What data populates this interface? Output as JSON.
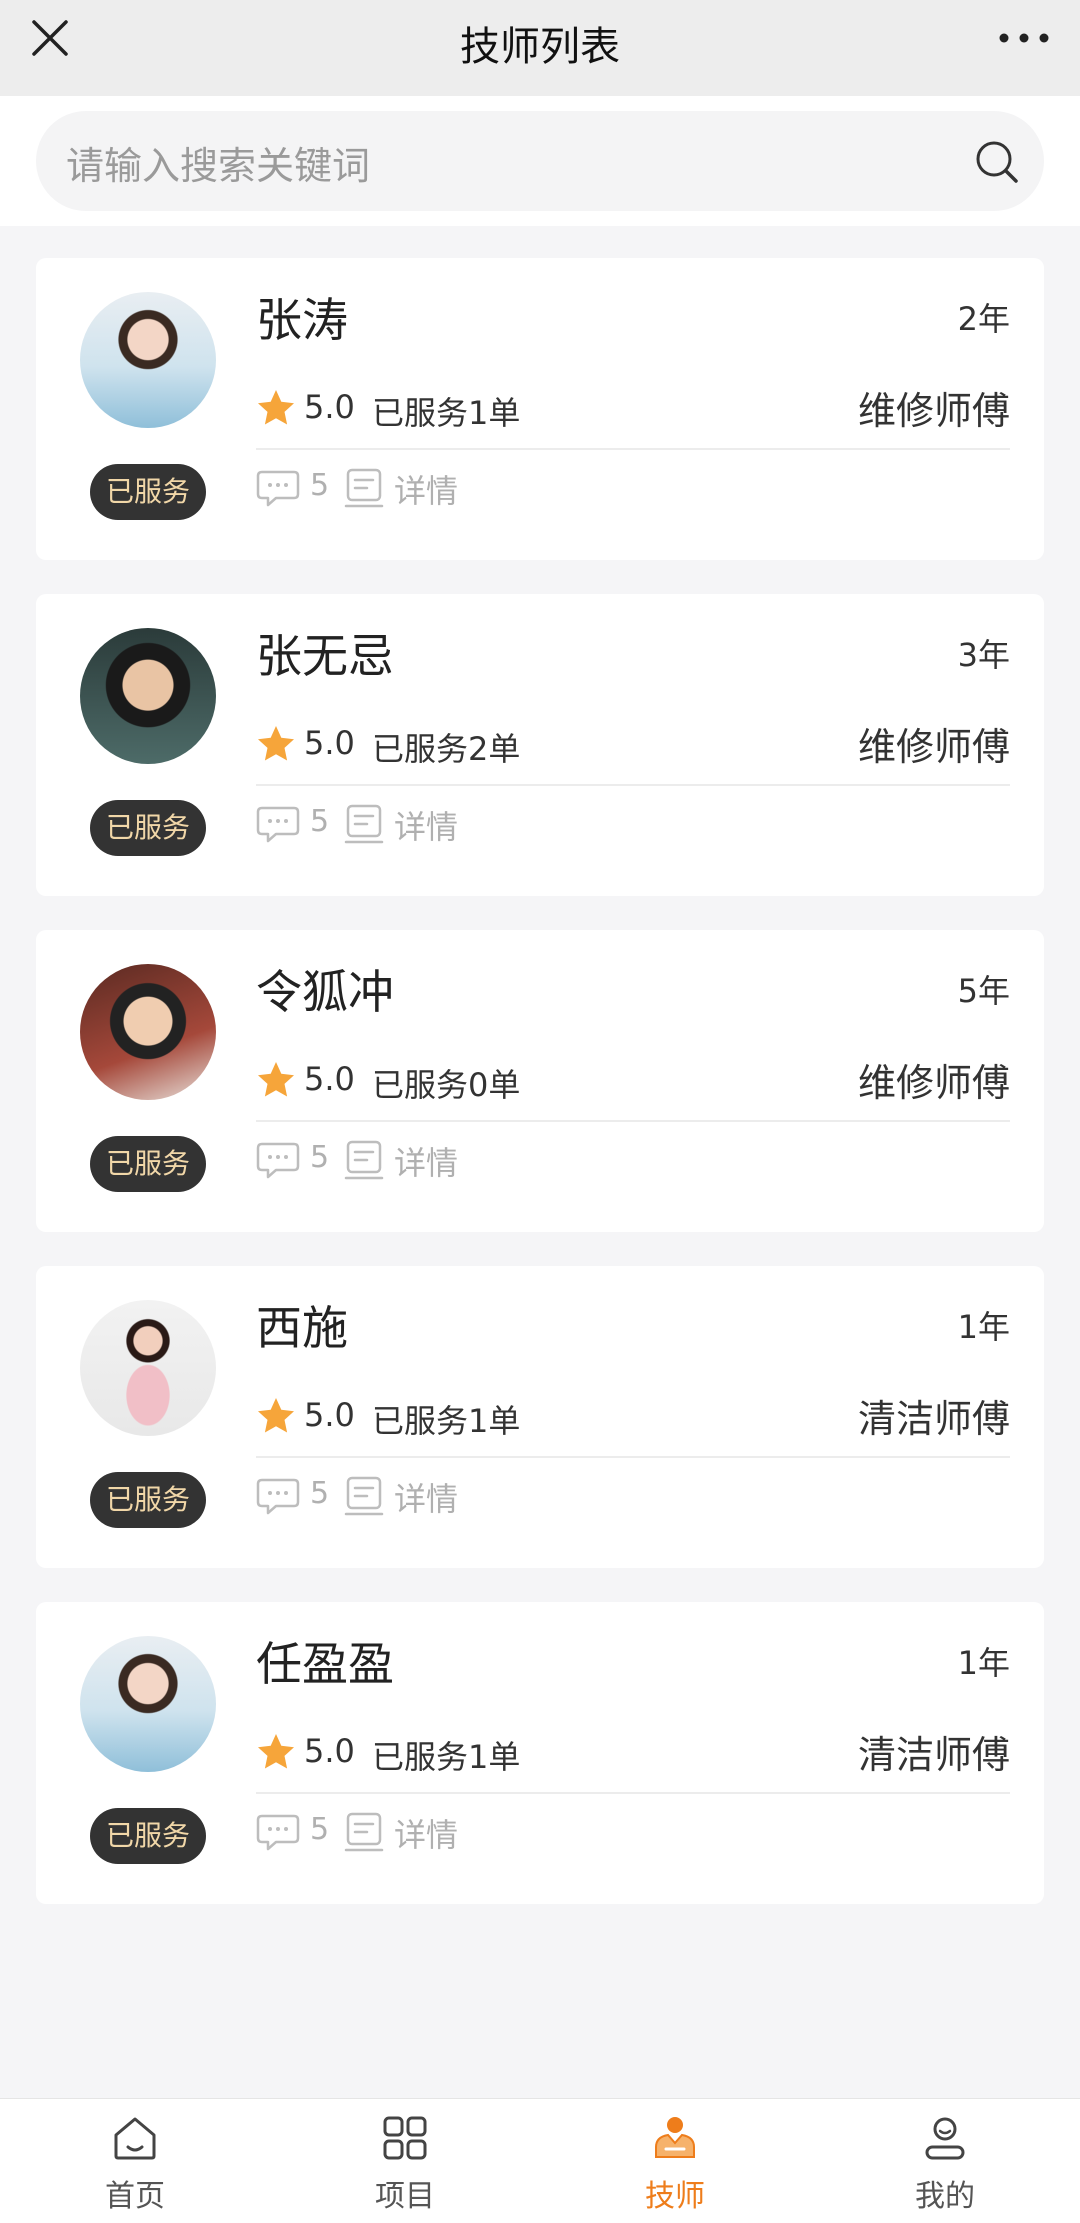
{
  "header": {
    "title": "技师列表",
    "close_icon": "close-icon",
    "more_icon": "more-dots-icon"
  },
  "search": {
    "placeholder": "请输入搜索关键词",
    "icon": "search-icon"
  },
  "colors": {
    "accent": "#ee7d1b",
    "star": "#f6a53a",
    "badge_bg": "#333333",
    "badge_text": "#f1d7a8"
  },
  "technicians": [
    {
      "name": "张涛",
      "years": "2年",
      "rating": "5.0",
      "served": "已服务1单",
      "role": "维修师傅",
      "badge": "已服务",
      "comments": "5",
      "detail": "详情"
    },
    {
      "name": "张无忌",
      "years": "3年",
      "rating": "5.0",
      "served": "已服务2单",
      "role": "维修师傅",
      "badge": "已服务",
      "comments": "5",
      "detail": "详情"
    },
    {
      "name": "令狐冲",
      "years": "5年",
      "rating": "5.0",
      "served": "已服务0单",
      "role": "维修师傅",
      "badge": "已服务",
      "comments": "5",
      "detail": "详情"
    },
    {
      "name": "西施",
      "years": "1年",
      "rating": "5.0",
      "served": "已服务1单",
      "role": "清洁师傅",
      "badge": "已服务",
      "comments": "5",
      "detail": "详情"
    },
    {
      "name": "任盈盈",
      "years": "1年",
      "rating": "5.0",
      "served": "已服务1单",
      "role": "清洁师傅",
      "badge": "已服务",
      "comments": "5",
      "detail": "详情"
    }
  ],
  "tabbar": {
    "items": [
      {
        "label": "首页",
        "icon": "home-icon",
        "active": false
      },
      {
        "label": "项目",
        "icon": "grid-icon",
        "active": false
      },
      {
        "label": "技师",
        "icon": "technician-icon",
        "active": true
      },
      {
        "label": "我的",
        "icon": "user-icon",
        "active": false
      }
    ]
  }
}
